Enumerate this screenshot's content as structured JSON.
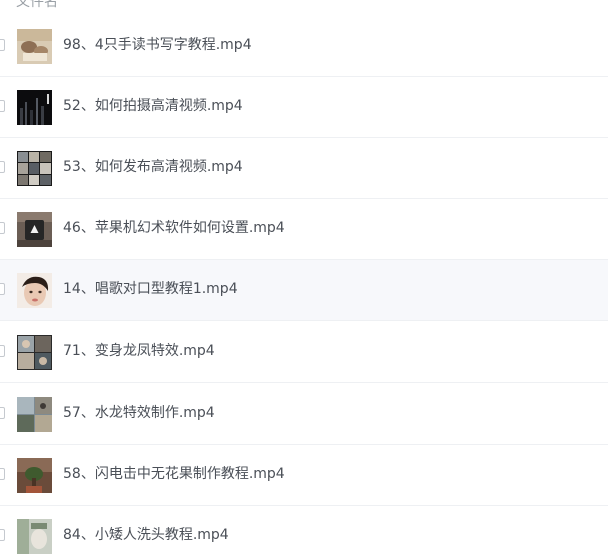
{
  "header": {
    "label": "文件名"
  },
  "files": [
    {
      "name": "98、4只手读书写字教程.mp4",
      "thumbnail": "video-thumbnail-hands-writing"
    },
    {
      "name": "52、如何拍摄高清视频.mp4",
      "thumbnail": "video-thumbnail-dark-city"
    },
    {
      "name": "53、如何发布高清视频.mp4",
      "thumbnail": "video-thumbnail-collage"
    },
    {
      "name": "46、苹果机幻术软件如何设置.mp4",
      "thumbnail": "video-thumbnail-phone-screen"
    },
    {
      "name": "14、唱歌对口型教程1.mp4",
      "thumbnail": "video-thumbnail-face"
    },
    {
      "name": "71、变身龙凤特效.mp4",
      "thumbnail": "video-thumbnail-collage"
    },
    {
      "name": "57、水龙特效制作.mp4",
      "thumbnail": "video-thumbnail-outdoor"
    },
    {
      "name": "58、闪电击中无花果制作教程.mp4",
      "thumbnail": "video-thumbnail-plant"
    },
    {
      "name": "84、小矮人洗头教程.mp4",
      "thumbnail": "video-thumbnail-washroom"
    }
  ]
}
